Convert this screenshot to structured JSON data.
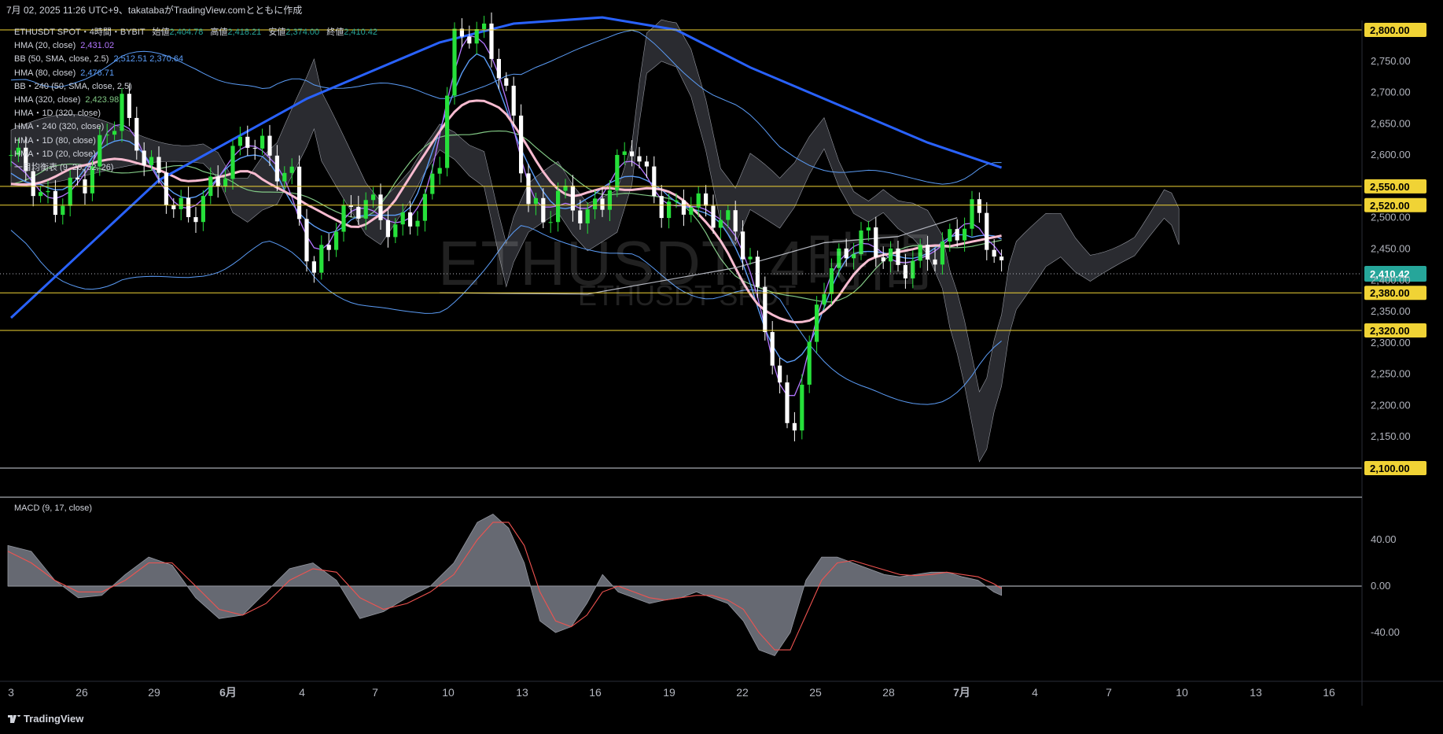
{
  "header": {
    "title": "7月 02, 2025 11:26 UTC+9、takatabaがTradingView.comとともに作成"
  },
  "legend": {
    "symbol": "ETHUSDT SPOT・4時間・BYBIT",
    "open_label": "始値",
    "open": "2,404.78",
    "high_label": "高値",
    "high": "2,418.21",
    "low_label": "安値",
    "low": "2,374.00",
    "close_label": "終値",
    "close": "2,410.42",
    "indicators": [
      {
        "name": "HMA (20, close)",
        "value": "2,431.02",
        "color": "#b376ff"
      },
      {
        "name": "BB (50, SMA, close, 2.5)",
        "value": "2,512.51  2,370.64",
        "color": "#5b9cf6"
      },
      {
        "name": "HMA (80, close)",
        "value": "2,476.71",
        "color": "#5b9cf6"
      },
      {
        "name": "BB・240 (50, SMA, close, 2.5)",
        "value": "",
        "color": "#d1d4dc"
      },
      {
        "name": "HMA (320, close)",
        "value": "2,423.98",
        "color": "#81c784"
      },
      {
        "name": "HMA・1D (320, close)",
        "value": "",
        "color": "#d1d4dc"
      },
      {
        "name": "HMA・240 (320, close)",
        "value": "",
        "color": "#d1d4dc"
      },
      {
        "name": "HMA・1D (80, close)",
        "value": "",
        "color": "#d1d4dc"
      },
      {
        "name": "HMA・1D (20, close)",
        "value": "",
        "color": "#d1d4dc"
      },
      {
        "name": "一目均衡表 (9, 26, 52, 26)",
        "value": "",
        "color": "#d1d4dc"
      }
    ]
  },
  "watermark": {
    "line1": "ETHUSDT, 4時間",
    "line2": "ETHUSDT SPOT"
  },
  "macd_label": "MACD (9, 17, close)",
  "footer": {
    "brand": "TradingView"
  },
  "colors": {
    "up": "#26e03a",
    "down": "#ffffff",
    "level": "#f0d335",
    "hma320_4h": "#2962ff",
    "pink": "#f8bbd0",
    "last_price": "#26a69a"
  },
  "chart_data": [
    {
      "type": "candlestick",
      "title": "ETHUSDT SPOT・4時間・BYBIT",
      "x_ticks": [
        "3",
        "26",
        "29",
        "6月",
        "4",
        "7",
        "10",
        "13",
        "16",
        "19",
        "22",
        "25",
        "28",
        "7月",
        "4",
        "7",
        "10",
        "13",
        "16"
      ],
      "y_ticks": [
        "2,100.00",
        "2,150.00",
        "2,200.00",
        "2,250.00",
        "2,300.00",
        "2,350.00",
        "2,400.00",
        "2,450.00",
        "2,500.00",
        "2,550.00",
        "2,600.00",
        "2,650.00",
        "2,700.00",
        "2,750.00",
        "2,800.00"
      ],
      "ylim": [
        2100,
        2800
      ],
      "horizontal_levels": [
        "2,800.00",
        "2,550.00",
        "2,520.00",
        "2,380.00",
        "2,320.00",
        "2,100.00"
      ],
      "last_price": "2,410.42",
      "price_path": [
        [
          0,
          2600
        ],
        [
          2,
          2580
        ],
        [
          4,
          2530
        ],
        [
          6,
          2520
        ],
        [
          8,
          2545
        ],
        [
          10,
          2560
        ],
        [
          12,
          2610
        ],
        [
          14,
          2660
        ],
        [
          15,
          2690
        ],
        [
          16,
          2640
        ],
        [
          18,
          2600
        ],
        [
          20,
          2560
        ],
        [
          22,
          2520
        ],
        [
          24,
          2500
        ],
        [
          26,
          2530
        ],
        [
          28,
          2560
        ],
        [
          30,
          2600
        ],
        [
          32,
          2630
        ],
        [
          34,
          2610
        ],
        [
          36,
          2580
        ],
        [
          38,
          2560
        ],
        [
          40,
          2450
        ],
        [
          41,
          2400
        ],
        [
          42,
          2440
        ],
        [
          44,
          2490
        ],
        [
          46,
          2510
        ],
        [
          48,
          2530
        ],
        [
          50,
          2500
        ],
        [
          52,
          2480
        ],
        [
          54,
          2500
        ],
        [
          56,
          2520
        ],
        [
          58,
          2600
        ],
        [
          59,
          2700
        ],
        [
          60,
          2780
        ],
        [
          62,
          2800
        ],
        [
          64,
          2790
        ],
        [
          66,
          2740
        ],
        [
          68,
          2650
        ],
        [
          70,
          2530
        ],
        [
          72,
          2490
        ],
        [
          74,
          2540
        ],
        [
          76,
          2520
        ],
        [
          78,
          2500
        ],
        [
          80,
          2530
        ],
        [
          82,
          2580
        ],
        [
          84,
          2620
        ],
        [
          86,
          2560
        ],
        [
          88,
          2520
        ],
        [
          90,
          2510
        ],
        [
          92,
          2530
        ],
        [
          94,
          2510
        ],
        [
          96,
          2500
        ],
        [
          98,
          2480
        ],
        [
          100,
          2430
        ],
        [
          101,
          2370
        ],
        [
          102,
          2330
        ],
        [
          103,
          2280
        ],
        [
          104,
          2220
        ],
        [
          105,
          2160
        ],
        [
          106,
          2180
        ],
        [
          107,
          2240
        ],
        [
          108,
          2280
        ],
        [
          109,
          2360
        ],
        [
          110,
          2400
        ],
        [
          112,
          2430
        ],
        [
          114,
          2460
        ],
        [
          116,
          2470
        ],
        [
          118,
          2440
        ],
        [
          120,
          2420
        ],
        [
          122,
          2430
        ],
        [
          124,
          2440
        ],
        [
          126,
          2450
        ],
        [
          128,
          2480
        ],
        [
          130,
          2510
        ],
        [
          131,
          2500
        ],
        [
          132,
          2470
        ],
        [
          133,
          2440
        ],
        [
          134,
          2410
        ]
      ]
    },
    {
      "type": "area",
      "title": "MACD (9, 17, close)",
      "y_ticks": [
        "40.00",
        "0.00",
        "-40.00"
      ],
      "ylim": [
        -68,
        62
      ],
      "macd": [
        [
          0,
          35
        ],
        [
          3,
          30
        ],
        [
          6,
          5
        ],
        [
          9,
          -10
        ],
        [
          12,
          -8
        ],
        [
          15,
          10
        ],
        [
          18,
          25
        ],
        [
          21,
          18
        ],
        [
          24,
          -10
        ],
        [
          27,
          -28
        ],
        [
          30,
          -25
        ],
        [
          33,
          -5
        ],
        [
          36,
          15
        ],
        [
          39,
          20
        ],
        [
          42,
          5
        ],
        [
          45,
          -28
        ],
        [
          48,
          -22
        ],
        [
          51,
          -10
        ],
        [
          54,
          0
        ],
        [
          57,
          20
        ],
        [
          60,
          55
        ],
        [
          62,
          62
        ],
        [
          64,
          50
        ],
        [
          66,
          20
        ],
        [
          68,
          -30
        ],
        [
          70,
          -40
        ],
        [
          72,
          -35
        ],
        [
          74,
          -15
        ],
        [
          76,
          10
        ],
        [
          78,
          -5
        ],
        [
          80,
          -10
        ],
        [
          82,
          -15
        ],
        [
          84,
          -12
        ],
        [
          86,
          -10
        ],
        [
          88,
          -5
        ],
        [
          90,
          -10
        ],
        [
          92,
          -15
        ],
        [
          94,
          -30
        ],
        [
          96,
          -55
        ],
        [
          98,
          -60
        ],
        [
          100,
          -40
        ],
        [
          102,
          5
        ],
        [
          104,
          25
        ],
        [
          106,
          25
        ],
        [
          108,
          20
        ],
        [
          110,
          15
        ],
        [
          112,
          10
        ],
        [
          114,
          8
        ],
        [
          116,
          10
        ],
        [
          118,
          12
        ],
        [
          120,
          12
        ],
        [
          122,
          8
        ],
        [
          124,
          5
        ],
        [
          126,
          -5
        ],
        [
          127,
          -8
        ]
      ],
      "signal": [
        [
          0,
          30
        ],
        [
          3,
          20
        ],
        [
          6,
          5
        ],
        [
          9,
          -5
        ],
        [
          12,
          -5
        ],
        [
          15,
          5
        ],
        [
          18,
          20
        ],
        [
          21,
          20
        ],
        [
          24,
          0
        ],
        [
          27,
          -20
        ],
        [
          30,
          -25
        ],
        [
          33,
          -15
        ],
        [
          36,
          5
        ],
        [
          39,
          15
        ],
        [
          42,
          12
        ],
        [
          45,
          -10
        ],
        [
          48,
          -20
        ],
        [
          51,
          -15
        ],
        [
          54,
          -5
        ],
        [
          57,
          10
        ],
        [
          60,
          40
        ],
        [
          62,
          55
        ],
        [
          64,
          55
        ],
        [
          66,
          35
        ],
        [
          68,
          -5
        ],
        [
          70,
          -30
        ],
        [
          72,
          -35
        ],
        [
          74,
          -25
        ],
        [
          76,
          -5
        ],
        [
          78,
          0
        ],
        [
          80,
          -5
        ],
        [
          82,
          -10
        ],
        [
          84,
          -12
        ],
        [
          86,
          -10
        ],
        [
          88,
          -8
        ],
        [
          90,
          -8
        ],
        [
          92,
          -12
        ],
        [
          94,
          -20
        ],
        [
          96,
          -40
        ],
        [
          98,
          -55
        ],
        [
          100,
          -55
        ],
        [
          102,
          -25
        ],
        [
          104,
          5
        ],
        [
          106,
          20
        ],
        [
          108,
          22
        ],
        [
          110,
          18
        ],
        [
          112,
          14
        ],
        [
          114,
          10
        ],
        [
          116,
          9
        ],
        [
          118,
          10
        ],
        [
          120,
          12
        ],
        [
          122,
          10
        ],
        [
          124,
          8
        ],
        [
          126,
          2
        ],
        [
          127,
          -2
        ]
      ]
    }
  ]
}
